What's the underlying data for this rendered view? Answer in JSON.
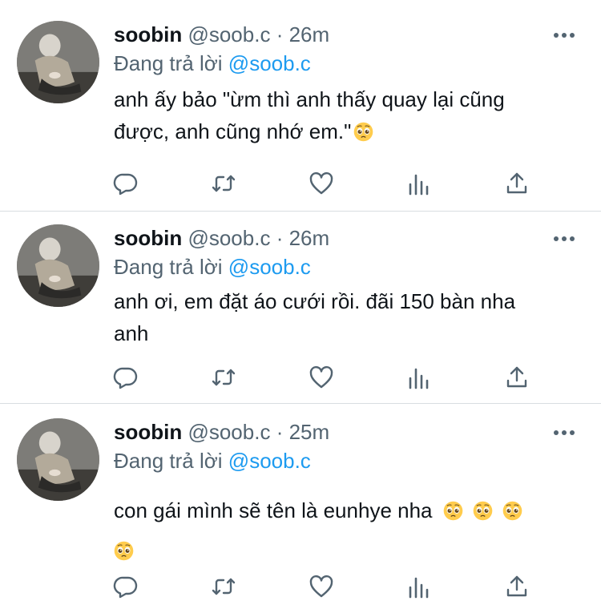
{
  "tweets": [
    {
      "name": "soobin",
      "handle": "@soob.c",
      "separator": "·",
      "time": "26m",
      "reply_prefix": "Đang trả lời",
      "reply_to": "@soob.c",
      "body_lines": [
        "anh ấy bảo \"ừm thì anh thấy quay lại cũng",
        "được, anh cũng nhớ em.\""
      ],
      "emoji": [
        "pleading-face"
      ]
    },
    {
      "name": "soobin",
      "handle": "@soob.c",
      "separator": "·",
      "time": "26m",
      "reply_prefix": "Đang trả lời",
      "reply_to": "@soob.c",
      "body_lines": [
        "anh ơi, em đặt áo cưới rồi. đãi 150 bàn nha",
        "anh"
      ],
      "emoji": []
    },
    {
      "name": "soobin",
      "handle": "@soob.c",
      "separator": "·",
      "time": "25m",
      "reply_prefix": "Đang trả lời",
      "reply_to": "@soob.c",
      "body_lines": [
        "con gái mình sẽ tên là eunhye nha"
      ],
      "emoji": [
        "pleading-face",
        "pleading-face",
        "pleading-face",
        "pleading-face"
      ]
    }
  ],
  "icons": {
    "more": "more-dots-icon",
    "reply": "reply-icon",
    "retweet": "retweet-icon",
    "like": "heart-icon",
    "views": "views-icon",
    "share": "share-icon"
  },
  "colors": {
    "text": "#0f1419",
    "secondary": "#536471",
    "link": "#1d9bf0",
    "divider": "#d9dde1"
  }
}
